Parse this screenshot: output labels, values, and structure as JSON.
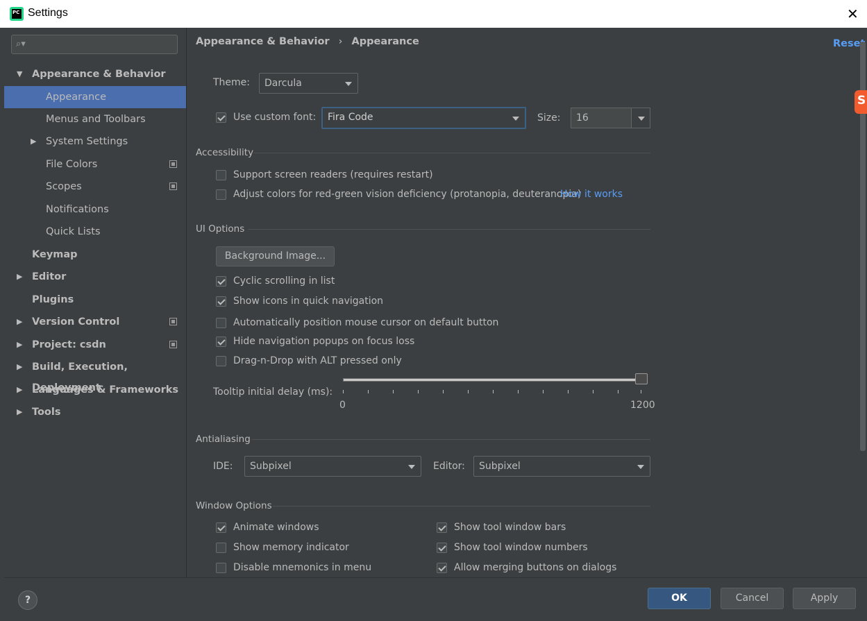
{
  "window": {
    "title": "Settings",
    "icon_text": "PC"
  },
  "sidebar": {
    "search_placeholder": "",
    "items": [
      {
        "label": "Appearance & Behavior",
        "expanded": true
      },
      {
        "label": "Appearance"
      },
      {
        "label": "Menus and Toolbars"
      },
      {
        "label": "System Settings"
      },
      {
        "label": "File Colors"
      },
      {
        "label": "Scopes"
      },
      {
        "label": "Notifications"
      },
      {
        "label": "Quick Lists"
      },
      {
        "label": "Keymap"
      },
      {
        "label": "Editor"
      },
      {
        "label": "Plugins"
      },
      {
        "label": "Version Control"
      },
      {
        "label": "Project: csdn"
      },
      {
        "label": "Build, Execution, Deployment"
      },
      {
        "label": "Languages & Frameworks"
      },
      {
        "label": "Tools"
      }
    ]
  },
  "breadcrumb": {
    "parent": "Appearance & Behavior",
    "separator": "›",
    "current": "Appearance"
  },
  "reset_label": "Reset",
  "theme": {
    "label": "Theme:",
    "value": "Darcula"
  },
  "custom_font": {
    "label": "Use custom font:",
    "checked": true,
    "value": "Fira Code",
    "size_label": "Size:",
    "size_value": "16"
  },
  "accessibility": {
    "title": "Accessibility",
    "screen_readers": {
      "label": "Support screen readers (requires restart)",
      "checked": false
    },
    "red_green": {
      "label": "Adjust colors for red-green vision deficiency (protanopia, deuteranopia)",
      "checked": false,
      "link": "How it works"
    }
  },
  "ui_options": {
    "title": "UI Options",
    "background_button": "Background Image...",
    "cyclic": {
      "label": "Cyclic scrolling in list",
      "checked": true
    },
    "show_icons": {
      "label": "Show icons in quick navigation",
      "checked": true
    },
    "auto_mouse": {
      "label": "Automatically position mouse cursor on default button",
      "checked": false
    },
    "hide_popups": {
      "label": "Hide navigation popups on focus loss",
      "checked": true
    },
    "drag_drop": {
      "label": "Drag-n-Drop with ALT pressed only",
      "checked": false
    },
    "tooltip": {
      "label": "Tooltip initial delay (ms):",
      "min": "0",
      "max": "1200",
      "value": 1200
    }
  },
  "antialiasing": {
    "title": "Antialiasing",
    "ide_label": "IDE:",
    "ide_value": "Subpixel",
    "editor_label": "Editor:",
    "editor_value": "Subpixel"
  },
  "window_options": {
    "title": "Window Options",
    "animate": {
      "label": "Animate windows",
      "checked": true
    },
    "memory": {
      "label": "Show memory indicator",
      "checked": false
    },
    "mnemonics": {
      "label": "Disable mnemonics in menu",
      "checked": false
    },
    "tool_bars": {
      "label": "Show tool window bars",
      "checked": true
    },
    "tool_numbers": {
      "label": "Show tool window numbers",
      "checked": true
    },
    "merging": {
      "label": "Allow merging buttons on dialogs",
      "checked": true
    }
  },
  "footer": {
    "help": "?",
    "ok": "OK",
    "cancel": "Cancel",
    "apply": "Apply"
  },
  "colors": {
    "accent": "#4b6eaf",
    "link": "#589df6",
    "background": "#3c3f41"
  }
}
